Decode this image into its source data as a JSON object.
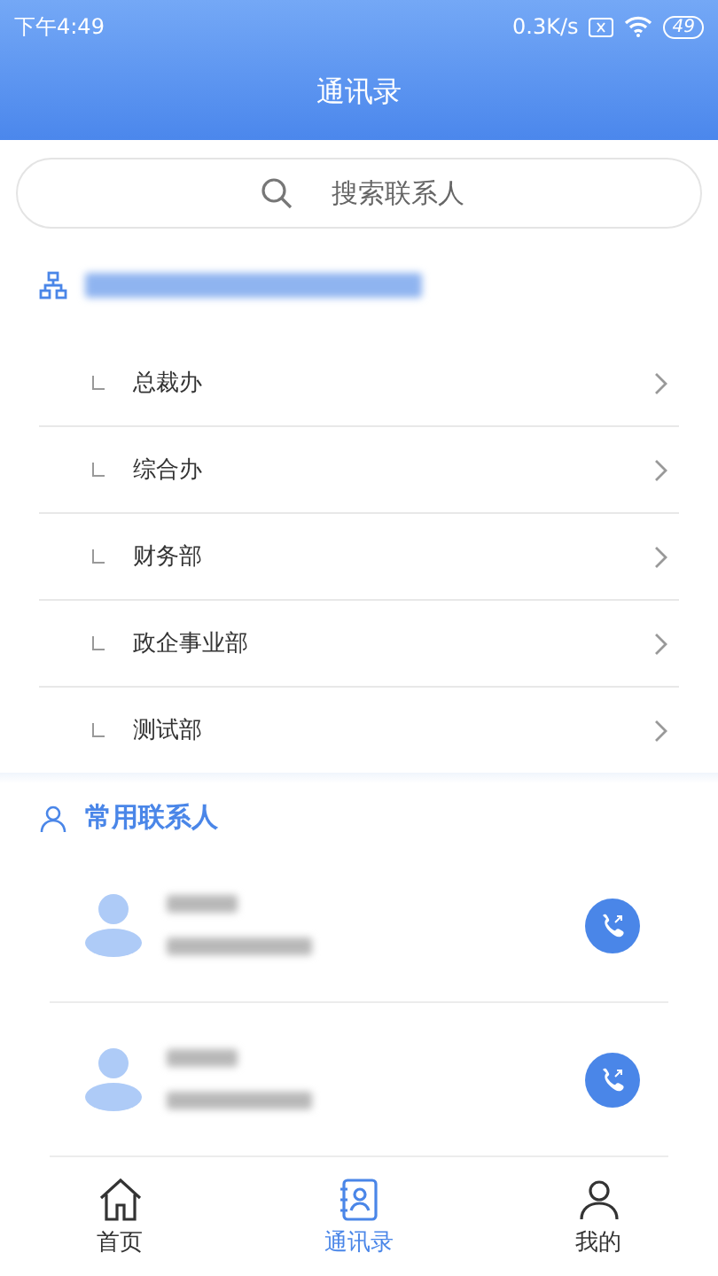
{
  "status_bar": {
    "time": "下午4:49",
    "speed": "0.3K/s",
    "battery": "49"
  },
  "header": {
    "title": "通讯录"
  },
  "search": {
    "placeholder": "搜索联系人"
  },
  "organization": {
    "redacted": true,
    "departments": [
      {
        "name": "总裁办"
      },
      {
        "name": "综合办"
      },
      {
        "name": "财务部"
      },
      {
        "name": "政企事业部"
      },
      {
        "name": "测试部"
      }
    ]
  },
  "frequent": {
    "title": "常用联系人",
    "contacts": [
      {
        "redacted": true
      },
      {
        "redacted": true
      }
    ]
  },
  "tabs": [
    {
      "label": "首页",
      "kind": "home",
      "selected": false
    },
    {
      "label": "通讯录",
      "kind": "contacts",
      "selected": true
    },
    {
      "label": "我的",
      "kind": "me",
      "selected": false
    }
  ]
}
